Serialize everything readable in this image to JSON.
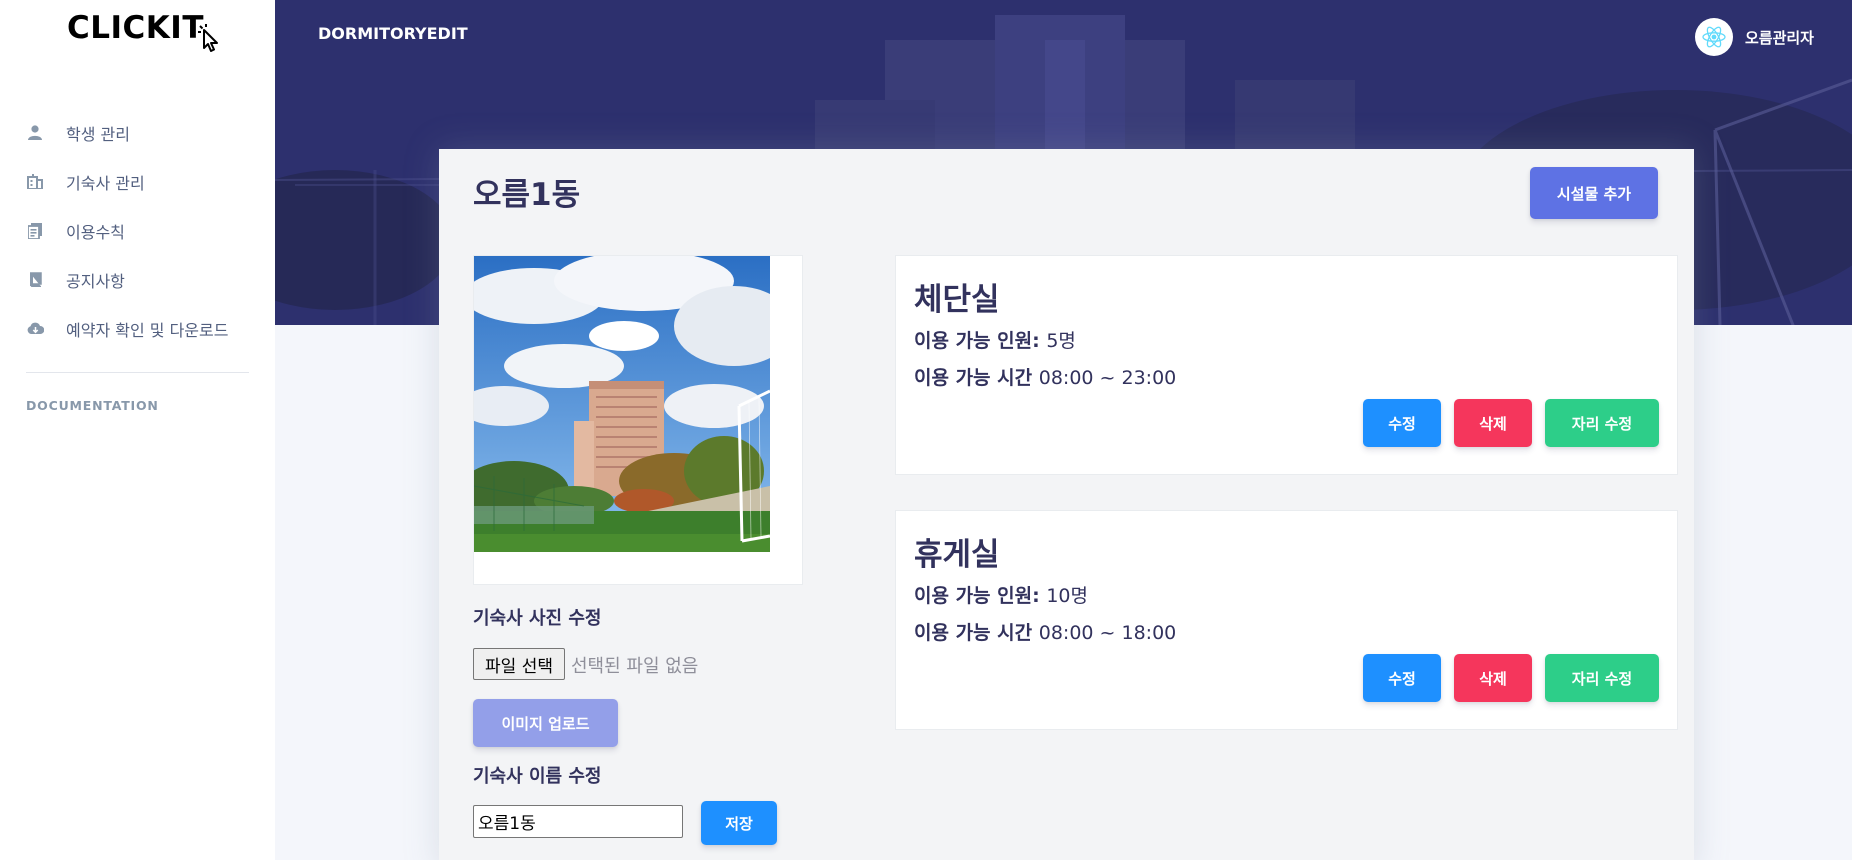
{
  "app": {
    "logo": "CLICKIT",
    "page_name": "DORMITORYEDIT"
  },
  "user": {
    "name": "오름관리자"
  },
  "sidebar": {
    "items": [
      {
        "label": "학생 관리",
        "icon": "person-icon"
      },
      {
        "label": "기숙사 관리",
        "icon": "building-icon"
      },
      {
        "label": "이용수칙",
        "icon": "document-icon"
      },
      {
        "label": "공지사항",
        "icon": "book-icon"
      },
      {
        "label": "예약자 확인 및 다운로드",
        "icon": "cloud-download-icon"
      }
    ],
    "heading": "DOCUMENTATION"
  },
  "main": {
    "title": "오름1동",
    "add_button": "시설물 추가",
    "photo_label": "기숙사 사진 수정",
    "file_button": "파일 선택",
    "file_status": "선택된 파일 없음",
    "upload_button": "이미지 업로드",
    "name_label": "기숙사 이름 수정",
    "name_value": "오름1동",
    "save_button": "저장"
  },
  "facilities": [
    {
      "name": "체단실",
      "capacity_label": "이용 가능 인원:",
      "capacity": "5명",
      "time_label": "이용 가능 시간",
      "time": "08:00 ~ 23:00",
      "edit": "수정",
      "delete": "삭제",
      "seat_edit": "자리 수정"
    },
    {
      "name": "휴게실",
      "capacity_label": "이용 가능 인원:",
      "capacity": "10명",
      "time_label": "이용 가능 시간",
      "time": "08:00 ~ 18:00",
      "edit": "수정",
      "delete": "삭제",
      "seat_edit": "자리 수정"
    }
  ],
  "colors": {
    "primary": "#5e72e4",
    "info": "#1e90ff",
    "danger": "#f5365c",
    "success": "#2dce89",
    "header": "#2c2f66"
  }
}
